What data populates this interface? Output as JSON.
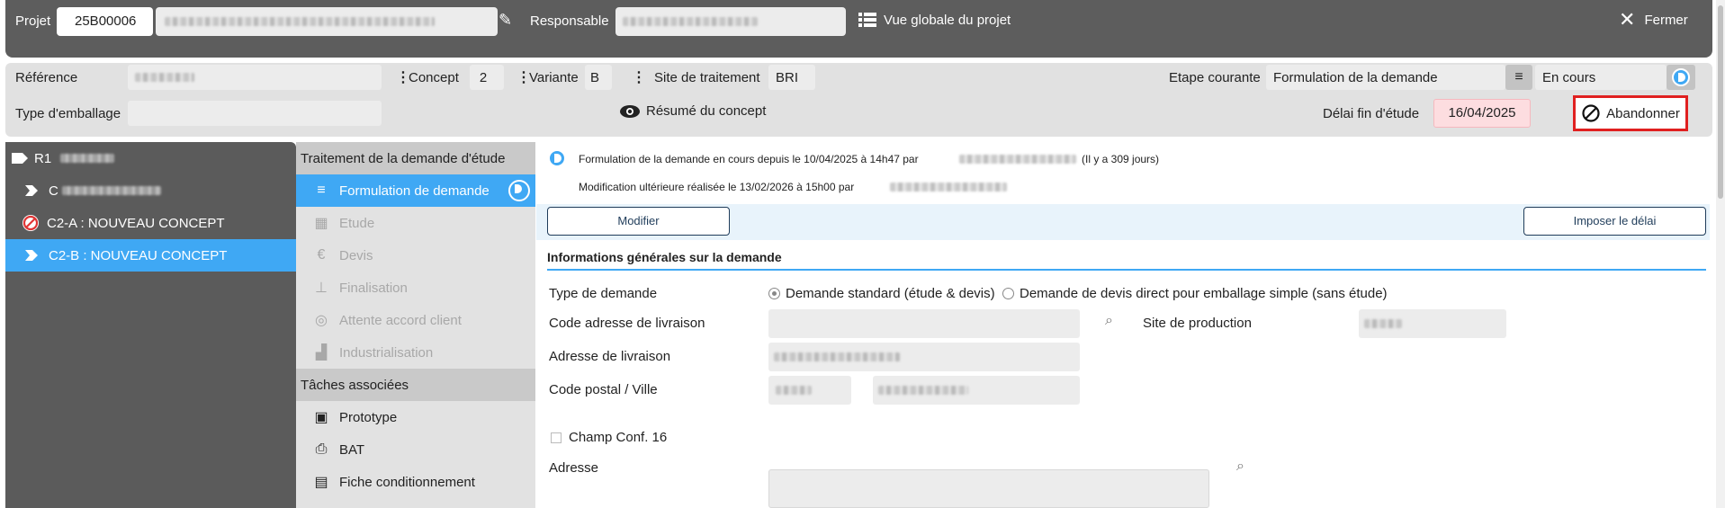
{
  "topbar": {
    "projet_label": "Projet",
    "projet_value": "25B00006",
    "responsable_label": "Responsable",
    "vue_globale": "Vue globale du projet",
    "fermer": "Fermer"
  },
  "ref": {
    "reference_label": "Référence",
    "concept_label": "Concept",
    "concept_value": "2",
    "variante_label": "Variante",
    "variante_value": "B",
    "site_label": "Site de traitement",
    "site_value": "BRI",
    "etape_label": "Etape courante",
    "etape_value": "Formulation de la demande",
    "statut_value": "En cours",
    "type_emballage_label": "Type d'emballage",
    "resume": "Résumé du concept",
    "delai_label": "Délai fin d'étude",
    "delai_value": "16/04/2025",
    "abandonner": "Abandonner"
  },
  "tree": {
    "items": [
      {
        "label": "R1"
      },
      {
        "label": "C"
      },
      {
        "label": "C2-A : NOUVEAU CONCEPT"
      },
      {
        "label": "C2-B : NOUVEAU CONCEPT"
      }
    ]
  },
  "steps": {
    "header1": "Traitement de la demande d'étude",
    "items": [
      {
        "label": "Formulation de demande",
        "icon": "edit-list-icon"
      },
      {
        "label": "Etude",
        "icon": "dashboard-icon"
      },
      {
        "label": "Devis",
        "icon": "euro-icon"
      },
      {
        "label": "Finalisation",
        "icon": "stamp-icon"
      },
      {
        "label": "Attente accord client",
        "icon": "handshake-icon"
      },
      {
        "label": "Industrialisation",
        "icon": "factory-icon"
      }
    ],
    "header2": "Tâches associées",
    "tasks": [
      {
        "label": "Prototype",
        "icon": "prototype-icon"
      },
      {
        "label": "BAT",
        "icon": "printer-icon"
      },
      {
        "label": "Fiche conditionnement",
        "icon": "clipboard-icon"
      }
    ]
  },
  "main": {
    "status_line1_a": "Formulation de la demande en cours depuis le 10/04/2025 à 14h47 par",
    "status_line1_b": "(Il y a 309 jours)",
    "status_line2": "Modification ultérieure réalisée le 13/02/2026 à 15h00 par",
    "modifier": "Modifier",
    "imposer": "Imposer le délai",
    "section_title": "Informations générales sur la demande",
    "type_demande_label": "Type de demande",
    "radio1": "Demande standard (étude & devis)",
    "radio2": "Demande de devis direct pour emballage simple (sans étude)",
    "code_adresse_label": "Code adresse de livraison",
    "site_production_label": "Site de production",
    "adresse_livraison_label": "Adresse de livraison",
    "code_postal_label": "Code postal / Ville",
    "champ_conf": "Champ Conf. 16",
    "adresse_label": "Adresse"
  },
  "colors": {
    "accent": "#3fa8f4",
    "topbar": "#5d5d5d",
    "highlight_red": "#e02020",
    "delai_bg": "#fddde0"
  }
}
